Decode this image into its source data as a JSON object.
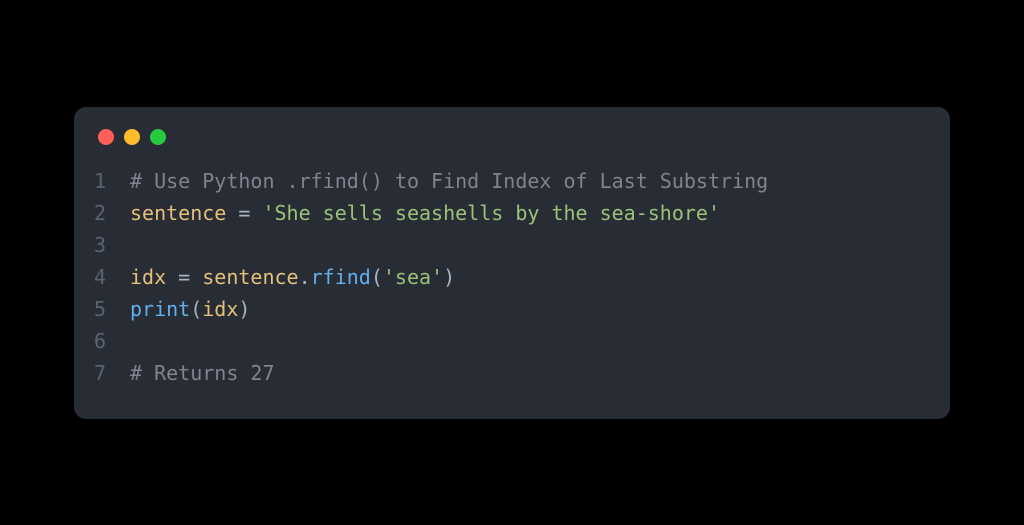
{
  "code": {
    "lines": [
      {
        "n": "1",
        "tokens": [
          {
            "cls": "comment",
            "t": "# Use Python .rfind() to Find Index of Last Substring"
          }
        ]
      },
      {
        "n": "2",
        "tokens": [
          {
            "cls": "ident",
            "t": "sentence"
          },
          {
            "cls": "op",
            "t": " = "
          },
          {
            "cls": "string",
            "t": "'She sells seashells by the sea-shore'"
          }
        ]
      },
      {
        "n": "3",
        "tokens": [
          {
            "cls": "plain",
            "t": ""
          }
        ]
      },
      {
        "n": "4",
        "tokens": [
          {
            "cls": "ident",
            "t": "idx"
          },
          {
            "cls": "op",
            "t": " = "
          },
          {
            "cls": "ident",
            "t": "sentence"
          },
          {
            "cls": "punct",
            "t": "."
          },
          {
            "cls": "method",
            "t": "rfind"
          },
          {
            "cls": "punct",
            "t": "("
          },
          {
            "cls": "string",
            "t": "'sea'"
          },
          {
            "cls": "punct",
            "t": ")"
          }
        ]
      },
      {
        "n": "5",
        "tokens": [
          {
            "cls": "func",
            "t": "print"
          },
          {
            "cls": "punct",
            "t": "("
          },
          {
            "cls": "ident",
            "t": "idx"
          },
          {
            "cls": "punct",
            "t": ")"
          }
        ]
      },
      {
        "n": "6",
        "tokens": [
          {
            "cls": "plain",
            "t": ""
          }
        ]
      },
      {
        "n": "7",
        "tokens": [
          {
            "cls": "comment",
            "t": "# Returns 27"
          }
        ]
      }
    ]
  }
}
